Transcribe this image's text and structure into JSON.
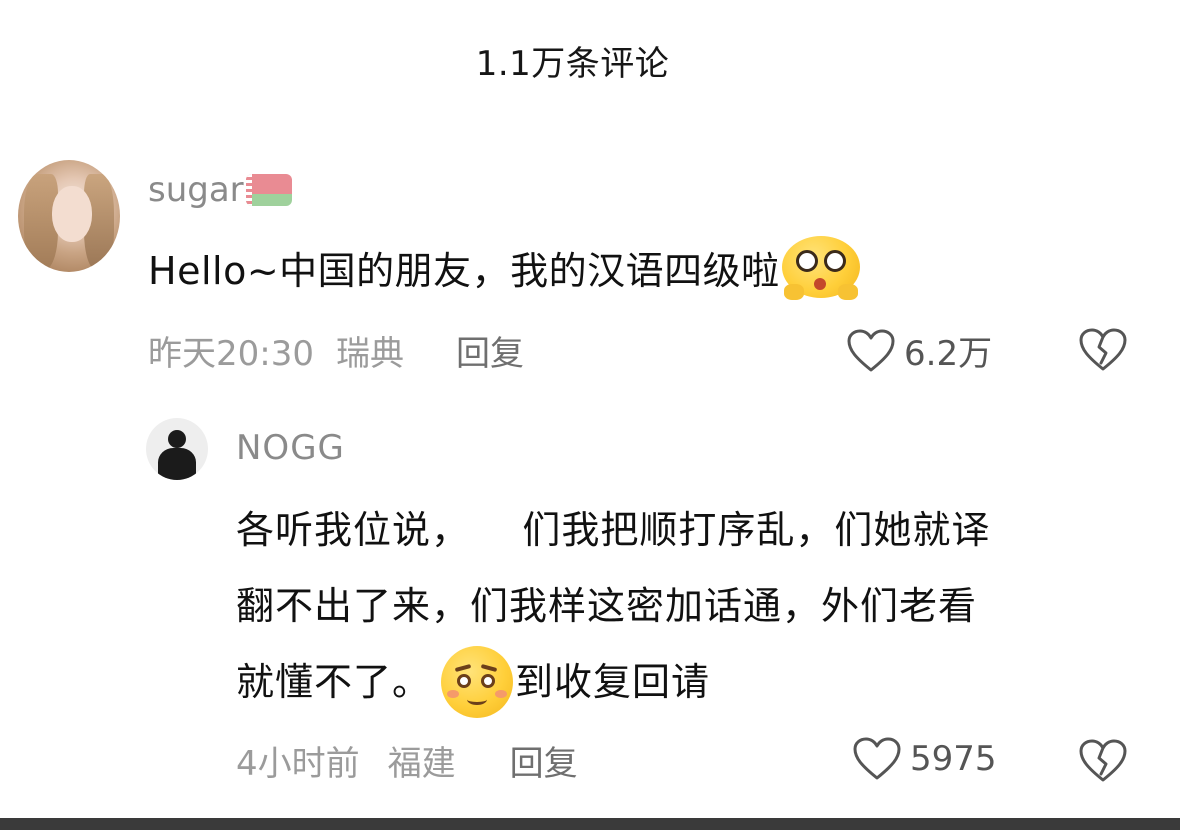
{
  "header": {
    "title": "1.1万条评论"
  },
  "comments": [
    {
      "username": "sugar",
      "flag": "belarus-flag",
      "text": "Hello~中国的朋友，我的汉语四级啦",
      "emoji": "pleading-face-emoji",
      "time": "昨天20:30",
      "location": "瑞典",
      "reply_label": "回复",
      "likes": "6.2万"
    },
    {
      "username": "NOGG",
      "text_lines": [
        "各听我位说，    们我把顺打序乱，们她就译",
        "翻不出了来，们我样这密加话通，外们老看",
        "就懂不了。"
      ],
      "text_after_emoji": "到收复回请",
      "emoji": "shy-face-emoji",
      "time": "4小时前",
      "location": "福建",
      "reply_label": "回复",
      "likes": "5975"
    }
  ],
  "colors": {
    "text_primary": "#111111",
    "text_secondary": "#9b9b9b",
    "username": "#8a8a8a"
  }
}
